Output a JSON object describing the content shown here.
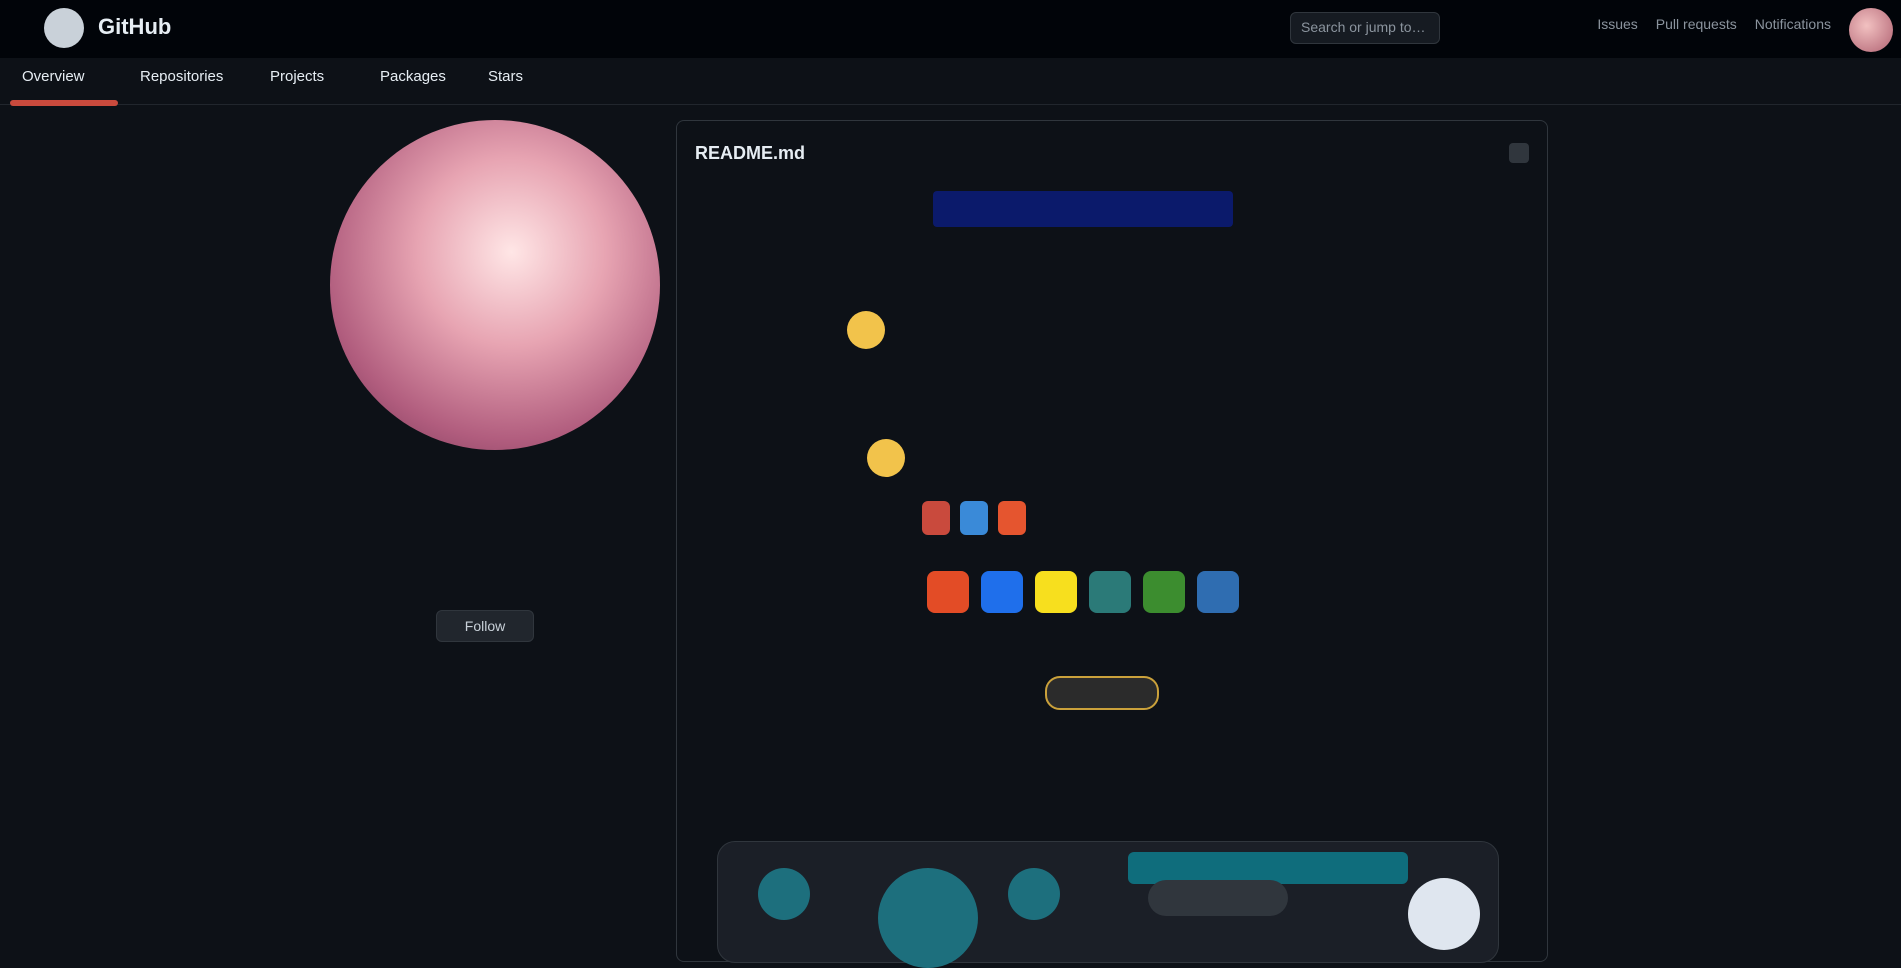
{
  "topbar": {
    "brand": "GitHub",
    "search_placeholder": "Search or jump to…",
    "actions": [
      "Issues",
      "Pull requests",
      "Notifications"
    ]
  },
  "tabs": [
    "Overview",
    "Repositories",
    "Projects",
    "Packages",
    "Stars"
  ],
  "profile": {
    "name": "",
    "login": "",
    "bio_lines": [
      "",
      ""
    ],
    "follow_button": "Follow",
    "meta_line": "",
    "meta_line2": "",
    "meta_line3": ""
  },
  "readme": {
    "title": "README.md",
    "banner_text": "",
    "line1": "",
    "line2": "",
    "line3": "",
    "line4": "",
    "label": "",
    "badges": [
      "",
      "",
      ""
    ],
    "view_pill": ""
  },
  "colors": {
    "accent_red": "#c94a3d",
    "accent_blue": "#3a8ad8",
    "accent_orange": "#e5552f",
    "teal": "#1d6f7d",
    "gold": "#caa13b"
  }
}
